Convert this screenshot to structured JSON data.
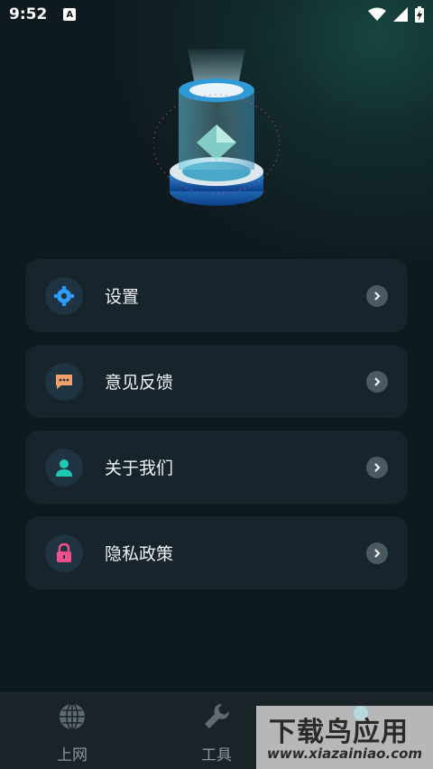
{
  "status_bar": {
    "time": "9:52",
    "notification_badge": "A"
  },
  "hero": {
    "icon": "hourglass-cylinder-illustration"
  },
  "menu": {
    "items": [
      {
        "label": "设置",
        "icon": "gear-icon",
        "icon_color": "#2e9bff"
      },
      {
        "label": "意见反馈",
        "icon": "chat-bubble-icon",
        "icon_color": "#f0a068"
      },
      {
        "label": "关于我们",
        "icon": "user-icon",
        "icon_color": "#1fc8b0"
      },
      {
        "label": "隐私政策",
        "icon": "lock-icon",
        "icon_color": "#f2508a"
      }
    ]
  },
  "bottom_nav": {
    "tabs": [
      {
        "label": "上网",
        "icon": "globe-icon"
      },
      {
        "label": "工具",
        "icon": "wrench-icon"
      },
      {
        "label": "",
        "icon": "profile-icon"
      }
    ]
  },
  "watermark": {
    "title": "下载鸟应用",
    "url": "www.xiazainiao.com"
  }
}
